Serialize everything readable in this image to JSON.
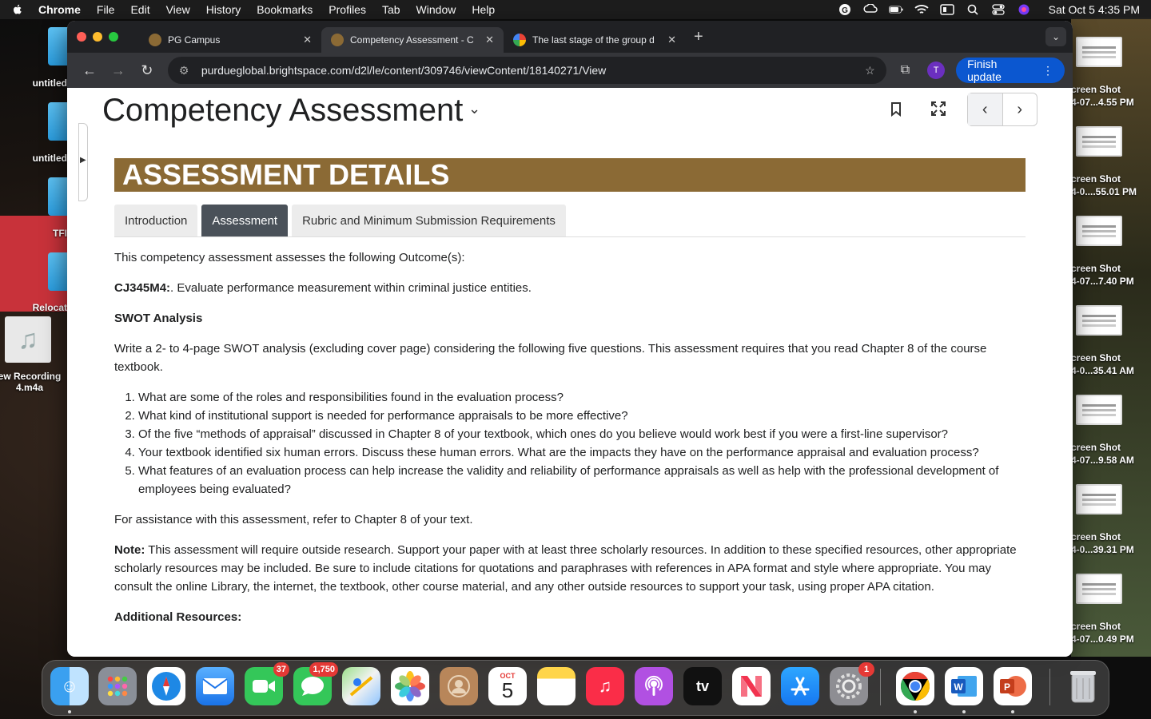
{
  "menubar": {
    "app_name": "Chrome",
    "items": [
      "File",
      "Edit",
      "View",
      "History",
      "Bookmarks",
      "Profiles",
      "Tab",
      "Window",
      "Help"
    ],
    "clock": "Sat Oct 5  4:35 PM"
  },
  "desktop_left": [
    {
      "label": "untitled"
    },
    {
      "label": "untitled"
    },
    {
      "label": "TFI"
    },
    {
      "label": "Relocat"
    },
    {
      "label": "ew Recording 4.m4a"
    }
  ],
  "desktop_right": [
    {
      "line1": "creen Shot",
      "line2": "4-07...4.55 PM"
    },
    {
      "line1": "creen Shot",
      "line2": "4-0....55.01 PM"
    },
    {
      "line1": "creen Shot",
      "line2": "4-07...7.40 PM"
    },
    {
      "line1": "creen Shot",
      "line2": "4-0...35.41 AM"
    },
    {
      "line1": "creen Shot",
      "line2": "4-07...9.58 AM"
    },
    {
      "line1": "creen Shot",
      "line2": "4-0...39.31 PM"
    },
    {
      "line1": "creen Shot",
      "line2": "4-07...0.49 PM"
    }
  ],
  "tabs": [
    {
      "title": "PG Campus"
    },
    {
      "title": "Competency Assessment - C"
    },
    {
      "title": "The last stage of the group d"
    }
  ],
  "toolbar": {
    "url": "purdueglobal.brightspace.com/d2l/le/content/309746/viewContent/18140271/View",
    "profile_initial": "T",
    "finish_label": "Finish update"
  },
  "page": {
    "title": "Competency Assessment",
    "banner": "ASSESSMENT DETAILS",
    "content_tabs": [
      "Introduction",
      "Assessment",
      "Rubric and Minimum Submission Requirements"
    ],
    "intro": "This competency assessment assesses the following Outcome(s):",
    "outcome_code": "CJ345M4:",
    "outcome_text": ". Evaluate performance measurement within criminal justice entities.",
    "swot_heading": "SWOT Analysis",
    "swot_text": "Write a 2- to 4-page SWOT analysis (excluding cover page) considering the following five questions. This assessment requires that you read Chapter 8 of the course textbook.",
    "questions": [
      "What are some of the roles and responsibilities found in the evaluation process?",
      "What kind of institutional support is needed for performance appraisals to be more effective?",
      "Of the five “methods of appraisal” discussed in Chapter 8 of your textbook, which ones do you believe would work best if you were a first-line supervisor?",
      "Your textbook identified six human errors. Discuss these human errors. What are the impacts they have on the performance appraisal and evaluation process?",
      "What features of an evaluation process can help increase the validity and reliability of performance appraisals as well as help with the professional development of employees being evaluated?"
    ],
    "assistance": "For assistance with this assessment, refer to Chapter 8 of your text.",
    "note_label": "Note:",
    "note_text": " This assessment will require outside research. Support your paper with at least three scholarly resources. In addition to these specified resources, other appropriate scholarly resources may be included. Be sure to include citations for quotations and paraphrases with references in APA format and style where appropriate. You may consult the online Library, the internet, the textbook, other course material, and any other outside resources to support your task, using proper APA citation.",
    "additional_heading": "Additional Resources:"
  },
  "dock": {
    "facetime_badge": "37",
    "messages_badge": "1,750",
    "calendar_month": "OCT",
    "calendar_day": "5",
    "tv_label": "tv",
    "settings_badge": "1"
  },
  "colors": {
    "banner": "#8b6a35",
    "active_tab": "#4a5159",
    "finish_button": "#0b57d0"
  }
}
